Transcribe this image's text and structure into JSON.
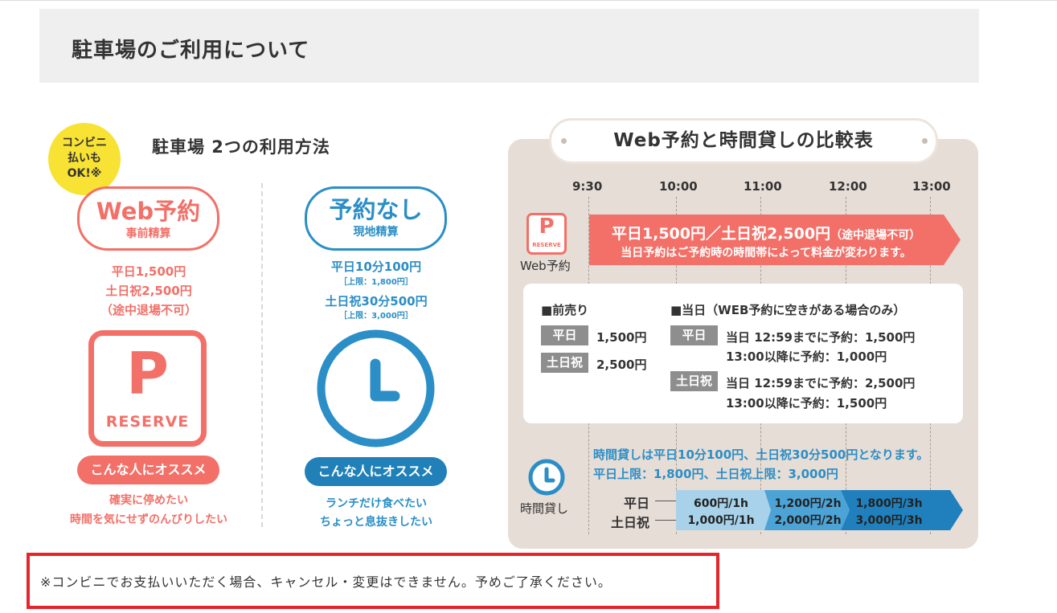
{
  "header": {
    "title": "駐車場のご利用について"
  },
  "badge": {
    "line1": "コンビニ",
    "line2": "払いも",
    "line3": "OK!※"
  },
  "methods": {
    "title": "駐車場 2つの利用方法",
    "web": {
      "label": "Web予約",
      "sub": "事前精算",
      "price1": "平日1,500円",
      "price2": "土日祝2,500円",
      "price3": "（途中退場不可）",
      "sign_letter": "P",
      "sign_text": "RESERVE",
      "recommend_label": "こんな人にオススメ",
      "recommend1": "確実に停めたい",
      "recommend2": "時間を気にせずのんびりしたい"
    },
    "none": {
      "label": "予約なし",
      "sub": "現地精算",
      "price1": "平日10分100円",
      "note1": "［上限：1,800円］",
      "price2": "土日祝30分500円",
      "note2": "［上限：3,000円］",
      "recommend_label": "こんな人にオススメ",
      "recommend1": "ランチだけ食べたい",
      "recommend2": "ちょっと息抜きしたい"
    }
  },
  "comparison": {
    "title": "Web予約と時間貸しの比較表",
    "times": [
      "9:30",
      "10:00",
      "11:00",
      "12:00",
      "13:00"
    ],
    "web_lane": {
      "label": "Web予約",
      "icon_letter": "P",
      "icon_text": "RESERVE",
      "main": "平日1,500円／土日祝2,500円",
      "main_note": "（途中退場不可）",
      "sub": "当日予約はご予約時の時間帯によって料金が変わります。"
    },
    "presale": {
      "heading": "■前売り",
      "weekday_tag": "平日",
      "weekday_price": "1,500円",
      "holiday_tag": "土日祝",
      "holiday_price": "2,500円"
    },
    "sameday": {
      "heading": "■当日（WEB予約に空きがある場合のみ）",
      "weekday_tag": "平日",
      "weekday_line1": "当日 12:59までに予約：1,500円",
      "weekday_line2": "13:00以降に予約：1,000円",
      "holiday_tag": "土日祝",
      "holiday_line1": "当日 12:59までに予約：2,500円",
      "holiday_line2": "13:00以降に予約：1,500円"
    },
    "hourly": {
      "label": "時間貸し",
      "text1": "時間貸しは平日10分100円、土日祝30分500円となります。",
      "text2": "平日上限：1,800円、土日祝上限：3,000円",
      "weekday_label": "平日",
      "holiday_label": "土日祝",
      "weekday": [
        "600円/1h",
        "1,200円/2h",
        "1,800円/3h"
      ],
      "holiday": [
        "1,000円/1h",
        "2,000円/2h",
        "3,000円/3h"
      ]
    },
    "colors": {
      "red": "#f27068",
      "blue": "#2b8ec6",
      "panel": "#e6ddd6"
    }
  },
  "notice": {
    "text": "※コンビニでお支払いいただく場合、キャンセル・変更はできません。予めご了承ください。"
  }
}
